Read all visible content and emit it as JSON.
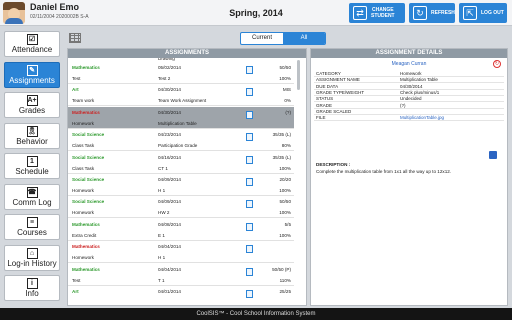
{
  "header": {
    "student_name": "Daniel Emo",
    "student_id": "02/11/2004 2020002B S-A",
    "term": "Spring, 2014",
    "buttons": [
      {
        "label_line1": "CHANGE",
        "label_line2": "STUDENT",
        "icon": "swap-arrows-icon"
      },
      {
        "label_line1": "REFRESH",
        "label_line2": "",
        "icon": "refresh-icon"
      },
      {
        "label_line1": "LOG OUT",
        "label_line2": "",
        "icon": "logout-icon"
      }
    ]
  },
  "sidebar": {
    "items": [
      {
        "label": "Attendance",
        "icon": "checkbox-icon",
        "glyph": "☑",
        "active": false
      },
      {
        "label": "Assignments",
        "icon": "pencil-icon",
        "glyph": "✎",
        "active": true
      },
      {
        "label": "Grades",
        "icon": "grade-card-icon",
        "glyph": "A+",
        "active": false
      },
      {
        "label": "Behavior",
        "icon": "ribbon-icon",
        "glyph": "🎗",
        "active": false
      },
      {
        "label": "Schedule",
        "icon": "calendar-icon",
        "glyph": "1",
        "active": false
      },
      {
        "label": "Comm Log",
        "icon": "phone-icon",
        "glyph": "☎",
        "active": false
      },
      {
        "label": "Courses",
        "icon": "books-icon",
        "glyph": "≡",
        "active": false
      },
      {
        "label": "Log-in History",
        "icon": "history-icon",
        "glyph": "⌂",
        "active": false
      },
      {
        "label": "Info",
        "icon": "info-icon",
        "glyph": "i",
        "active": false
      }
    ]
  },
  "filter": {
    "current_label": "Current",
    "all_label": "All",
    "selected": "All"
  },
  "assignments": {
    "title": "ASSIGNMENTS",
    "partial_top": "Drawing",
    "rows": [
      {
        "course": "Mathematics",
        "course_color": "#2e9a2e",
        "date": "05/02/2014",
        "score": "50/50",
        "type": "Test",
        "title": "Test 2",
        "pct": "100%"
      },
      {
        "course": "Art",
        "course_color": "#2e9a2e",
        "date": "04/30/2014",
        "score": "MIS",
        "type": "Team work",
        "title": "Team Work Assignment",
        "pct": "0%"
      },
      {
        "course": "Mathematics",
        "course_color": "#cc2222",
        "date": "04/30/2014",
        "score": "(?)",
        "type": "Homework",
        "title": "Multiplication Table",
        "pct": "",
        "selected": true
      },
      {
        "course": "Social Science",
        "course_color": "#2e9a2e",
        "date": "04/23/2014",
        "score": "35/35 (L)",
        "type": "Class Task",
        "title": "Participation Grade",
        "pct": "80%"
      },
      {
        "course": "Social Science",
        "course_color": "#2e9a2e",
        "date": "04/16/2014",
        "score": "35/35 (L)",
        "type": "Class Task",
        "title": "CT 1",
        "pct": "100%"
      },
      {
        "course": "Social Science",
        "course_color": "#2e9a2e",
        "date": "04/09/2014",
        "score": "20/20",
        "type": "Homework",
        "title": "H 1",
        "pct": "100%"
      },
      {
        "course": "Social Science",
        "course_color": "#2e9a2e",
        "date": "04/09/2014",
        "score": "50/50",
        "type": "Homework",
        "title": "HW 2",
        "pct": "100%"
      },
      {
        "course": "Mathematics",
        "course_color": "#2e9a2e",
        "date": "04/08/2014",
        "score": "5/5",
        "type": "Extra Credit",
        "title": "E 1",
        "pct": "100%"
      },
      {
        "course": "Mathematics",
        "course_color": "#cc2222",
        "date": "04/04/2014",
        "score": "",
        "type": "Homework",
        "title": "H 1",
        "pct": ""
      },
      {
        "course": "Mathematics",
        "course_color": "#2e9a2e",
        "date": "04/04/2014",
        "score": "50/50 (P)",
        "type": "Test",
        "title": "T 1",
        "pct": "110%"
      },
      {
        "course": "Art",
        "course_color": "#2e9a2e",
        "date": "04/01/2014",
        "score": "25/25",
        "type": "",
        "title": "",
        "pct": ""
      }
    ]
  },
  "details": {
    "title": "ASSIGNMENT DETAILS",
    "teacher": "Meagan Curran",
    "fields": [
      {
        "key": "CATEGORY",
        "value": "Homework"
      },
      {
        "key": "ASSIGNMENT NAME",
        "value": "Multiplication Table"
      },
      {
        "key": "DUE DATA",
        "value": "04/30/2014"
      },
      {
        "key": "GRADE TYPE/WEIGHT",
        "value": "Check plus/minus/1"
      },
      {
        "key": "STATUS",
        "value": "Undecided"
      },
      {
        "key": "GRADE",
        "value": "(?)"
      },
      {
        "key": "GRADE SCALED",
        "value": ""
      },
      {
        "key": "FILE",
        "value": "MultiplicationTable.jpg",
        "link": true
      }
    ],
    "description_label": "DESCRIPTION :",
    "description": "Complete the multiplication table from 1x1 all the way up to 12x12."
  },
  "footer": {
    "text": "CoolSIS™ - Cool School Information System"
  },
  "colors": {
    "accent": "#2b84d6",
    "header_bg": "#8f9aa4",
    "selected_row": "#9ea4aa"
  }
}
